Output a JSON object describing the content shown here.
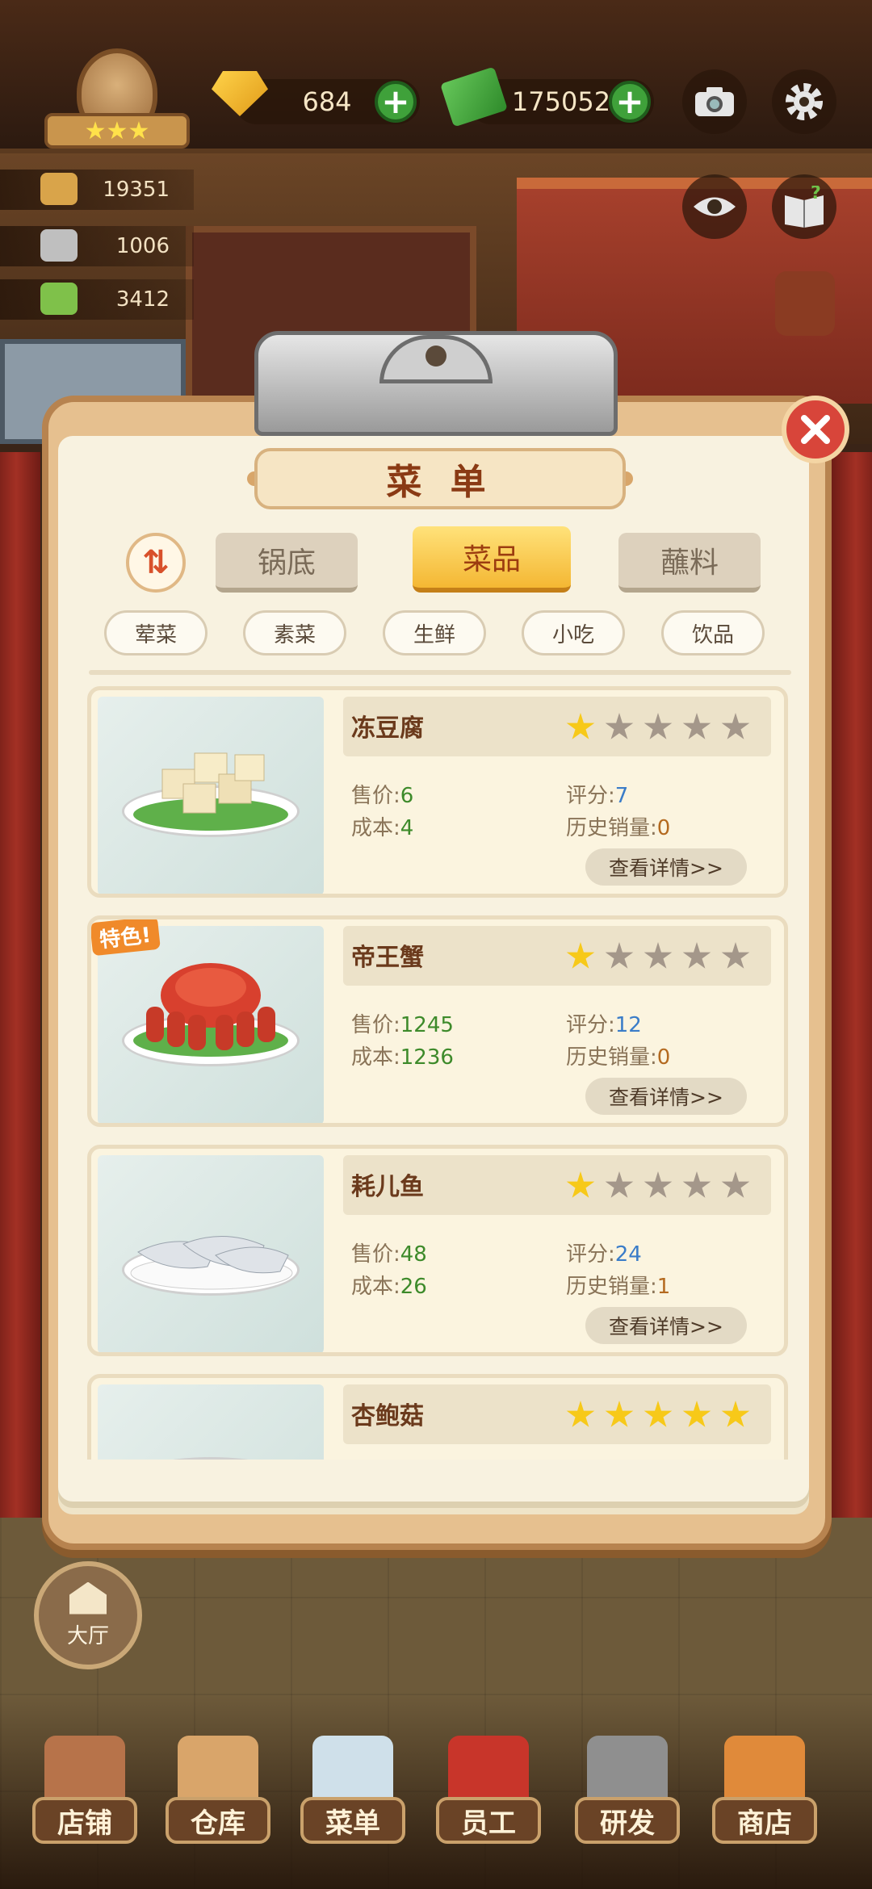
{
  "hud": {
    "gems": "684",
    "cash": "175052",
    "stats": [
      "19351",
      "1006",
      "3412"
    ],
    "icons": [
      "gold-badge-icon",
      "gem-icon",
      "cash-icon",
      "camera-icon",
      "gear-icon",
      "eye-icon",
      "help-book-icon",
      "recipe-book-icon"
    ]
  },
  "menu": {
    "title": "菜 单",
    "sort_label": "⇅",
    "tabs": [
      "锅底",
      "菜品",
      "蘸料"
    ],
    "active_tab": "菜品",
    "chips": [
      "荤菜",
      "素菜",
      "生鲜",
      "小吃",
      "饮品"
    ],
    "price_label": "售价:",
    "cost_label": "成本:",
    "score_label": "评分:",
    "sales_label": "历史销量:",
    "detail_label": "查看详情>>",
    "special_label": "特色!",
    "dishes": [
      {
        "name": "冻豆腐",
        "price": "6",
        "cost": "4",
        "score": "7",
        "sales": "0",
        "stars": 1,
        "special": false
      },
      {
        "name": "帝王蟹",
        "price": "1245",
        "cost": "1236",
        "score": "12",
        "sales": "0",
        "stars": 1,
        "special": true
      },
      {
        "name": "耗儿鱼",
        "price": "48",
        "cost": "26",
        "score": "24",
        "sales": "1",
        "stars": 1,
        "special": false
      },
      {
        "name": "杏鲍菇",
        "stars": 5,
        "special": false
      }
    ]
  },
  "hall_label": "大厅",
  "nav": [
    "店铺",
    "仓库",
    "菜单",
    "员工",
    "研发",
    "商店"
  ],
  "colors": {
    "active_tab": "#f4b733",
    "star_on": "#f7c919",
    "star_off": "#a4978a",
    "close": "#d8453a"
  }
}
